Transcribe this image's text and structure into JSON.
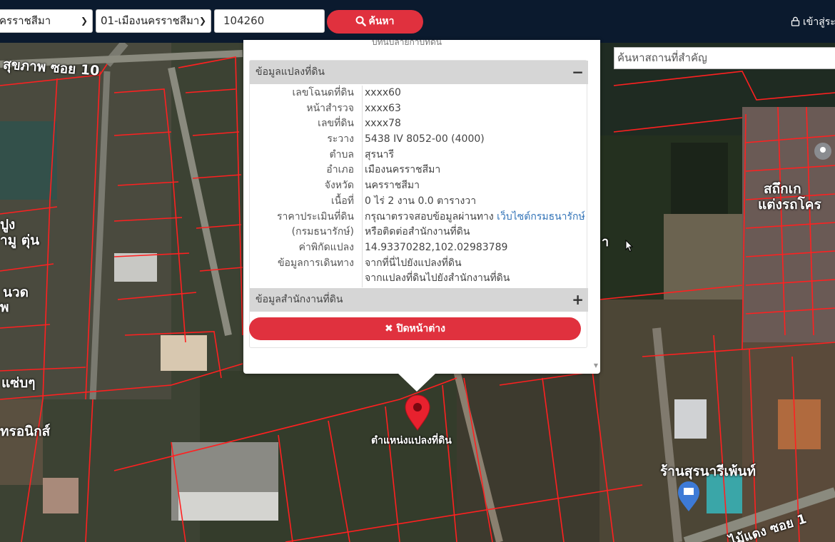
{
  "topbar": {
    "province": "ครราชสีมา",
    "district": "01-เมืองนครราชสีมา",
    "parcel_number": "104260",
    "search_label": "ค้นหา",
    "login_label": "เข้าสู่ระ"
  },
  "map": {
    "place_search_placeholder": "ค้นหาสถานที่สำคัญ",
    "labels": {
      "soi": "สุขภาพ ซอย 10",
      "shop1a": "สถึกเก",
      "shop1b": "แต่งรถโคร",
      "left1": "ปูง",
      "left2": "ามู ตุ่น",
      "left3": "นวด",
      "left4": "พ",
      "left5": "แซ่บๆ",
      "left6": "ทรอนิกส์",
      "shop2": "ร้านสุรนารีเพ้นท์",
      "road": "ไม้แดง ซอย 1",
      "mid": "า"
    },
    "pin_label": "ตำแหน่งแปลงที่ดิน"
  },
  "popup": {
    "truncated_top": "บทนบลายกาบทดน",
    "land_panel_title": "ข้อมูลแปลงที่ดิน",
    "land_panel_toggle": "−",
    "rows": [
      {
        "label": "เลขโฉนดที่ดิน",
        "value": "xxxx60"
      },
      {
        "label": "หน้าสำรวจ",
        "value": "xxxx63"
      },
      {
        "label": "เลขที่ดิน",
        "value": "xxxx78"
      },
      {
        "label": "ระวาง",
        "value": "5438 IV 8052-00 (4000)"
      },
      {
        "label": "ตำบล",
        "value": "สุรนารี"
      },
      {
        "label": "อำเภอ",
        "value": "เมืองนครราชสีมา"
      },
      {
        "label": "จังหวัด",
        "value": "นครราชสีมา"
      },
      {
        "label": "เนื้อที่",
        "value": "0 ไร่ 2 งาน 0.0 ตารางวา"
      }
    ],
    "price_label": "ราคาประเมินที่ดิน",
    "price_label2": "(กรมธนารักษ์)",
    "price_value": "กรุณาตรวจสอบข้อมูลผ่านทาง ",
    "price_link": "เว็บไซต์กรมธนารักษ์",
    "price_value2": "หรือติดต่อสำนักงานที่ดิน",
    "coord_label": "ค่าพิกัดแปลง",
    "coord_value": "14.93370282,102.02983789",
    "travel_label": "ข้อมูลการเดินทาง",
    "travel_link1": "จากที่นี่ไปยังแปลงที่ดิน",
    "travel_link2": "จากแปลงที่ดินไปยังสำนักงานที่ดิน",
    "office_panel_title": "ข้อมูลสำนักงานที่ดิน",
    "office_panel_toggle": "+",
    "close_label": "ปิดหน้าต่าง"
  },
  "colors": {
    "topbar": "#0b1a2e",
    "accent_red": "#e0313e",
    "link_blue": "#3374b8",
    "parcel_line": "#ff2020"
  }
}
